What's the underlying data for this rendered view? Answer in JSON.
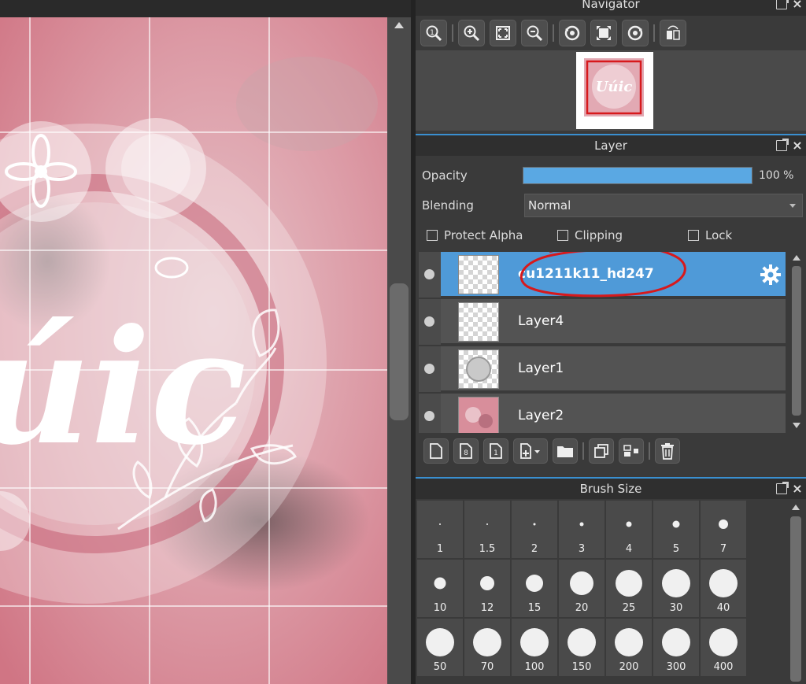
{
  "canvas": {
    "artwork_text": "úic"
  },
  "navigator": {
    "title": "Navigator",
    "thumbnail_text": "Uúic",
    "tools": [
      "zoom-actual-icon",
      "zoom-in-icon",
      "fit-screen-icon",
      "zoom-out-icon",
      "rotate-left-icon",
      "reset-view-icon",
      "rotate-right-icon",
      "flip-horizontal-icon"
    ]
  },
  "layer_panel": {
    "title": "Layer",
    "opacity_label": "Opacity",
    "opacity_value": "100 %",
    "opacity_fraction": 1.0,
    "blending_label": "Blending",
    "blending_value": "Normal",
    "checkboxes": {
      "protect_alpha": "Protect Alpha",
      "clipping": "Clipping",
      "lock": "Lock"
    },
    "layers": [
      {
        "name": "cu1211k11_hd247",
        "selected": true
      },
      {
        "name": "Layer4",
        "selected": false
      },
      {
        "name": "Layer1",
        "selected": false
      },
      {
        "name": "Layer2",
        "selected": false
      }
    ]
  },
  "brush_panel": {
    "title": "Brush Size",
    "sizes": [
      "1",
      "1.5",
      "2",
      "3",
      "4",
      "5",
      "7",
      "10",
      "12",
      "15",
      "20",
      "25",
      "30",
      "40",
      "50",
      "70",
      "100",
      "150",
      "200",
      "300",
      "400"
    ]
  },
  "colors": {
    "accent": "#4f9ad8",
    "annotation": "#d7191c",
    "canvas_pink": "#d98a97"
  }
}
